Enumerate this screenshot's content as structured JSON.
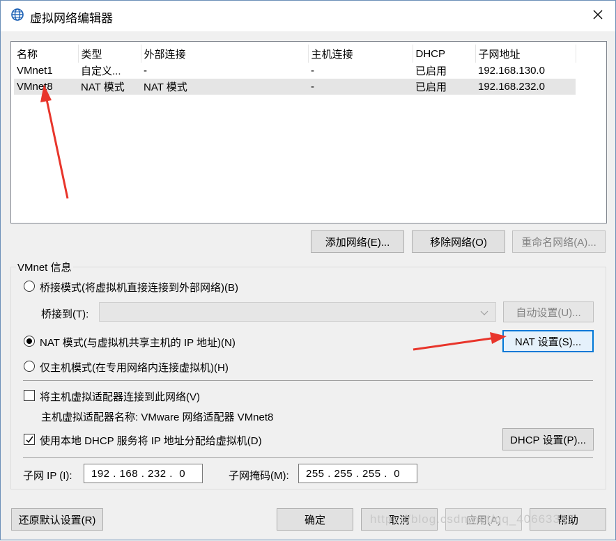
{
  "window": {
    "title": "虚拟网络编辑器"
  },
  "icons": {
    "app": "globe-network-icon",
    "close": "close-icon",
    "dropdown": "chevron-down-icon",
    "check": "checkmark-icon"
  },
  "colors": {
    "arrow": "#e8352b",
    "focus": "#0078d7",
    "selection": "#e5e5e5"
  },
  "network_table": {
    "columns": [
      "名称",
      "类型",
      "外部连接",
      "主机连接",
      "DHCP",
      "子网地址"
    ],
    "rows": [
      [
        "VMnet1",
        "自定义...",
        "-",
        "-",
        "已启用",
        "192.168.130.0"
      ],
      [
        "VMnet8",
        "NAT 模式",
        "NAT 模式",
        "-",
        "已启用",
        "192.168.232.0"
      ]
    ],
    "selected_row": 1
  },
  "list_buttons": {
    "add": "添加网络(E)...",
    "remove": "移除网络(O)",
    "rename": "重命名网络(A)..."
  },
  "vmnet_info": {
    "group_label": "VMnet 信息",
    "bridge_mode": "桥接模式(将虚拟机直接连接到外部网络)(B)",
    "bridge_to_label": "桥接到(T):",
    "bridge_to_value": "",
    "auto_settings": "自动设置(U)...",
    "nat_mode": "NAT 模式(与虚拟机共享主机的 IP 地址)(N)",
    "nat_settings": "NAT 设置(S)...",
    "host_only_mode": "仅主机模式(在专用网络内连接虚拟机)(H)",
    "selected_mode": "nat",
    "connect_adapter": "将主机虚拟适配器连接到此网络(V)",
    "connect_adapter_checked": false,
    "adapter_name": "主机虚拟适配器名称: VMware 网络适配器 VMnet8",
    "use_dhcp": "使用本地 DHCP 服务将 IP 地址分配给虚拟机(D)",
    "use_dhcp_checked": true,
    "dhcp_settings": "DHCP 设置(P)...",
    "subnet_ip_label": "子网 IP (I):",
    "subnet_ip": "192 . 168 . 232 .  0",
    "subnet_mask_label": "子网掩码(M):",
    "subnet_mask": "255 . 255 . 255 .  0"
  },
  "footer_buttons": {
    "restore": "还原默认设置(R)",
    "ok": "确定",
    "cancel": "取消",
    "apply": "应用(A)",
    "help": "帮助"
  },
  "watermark": "https://blog.csdn.net/qq_40663357"
}
